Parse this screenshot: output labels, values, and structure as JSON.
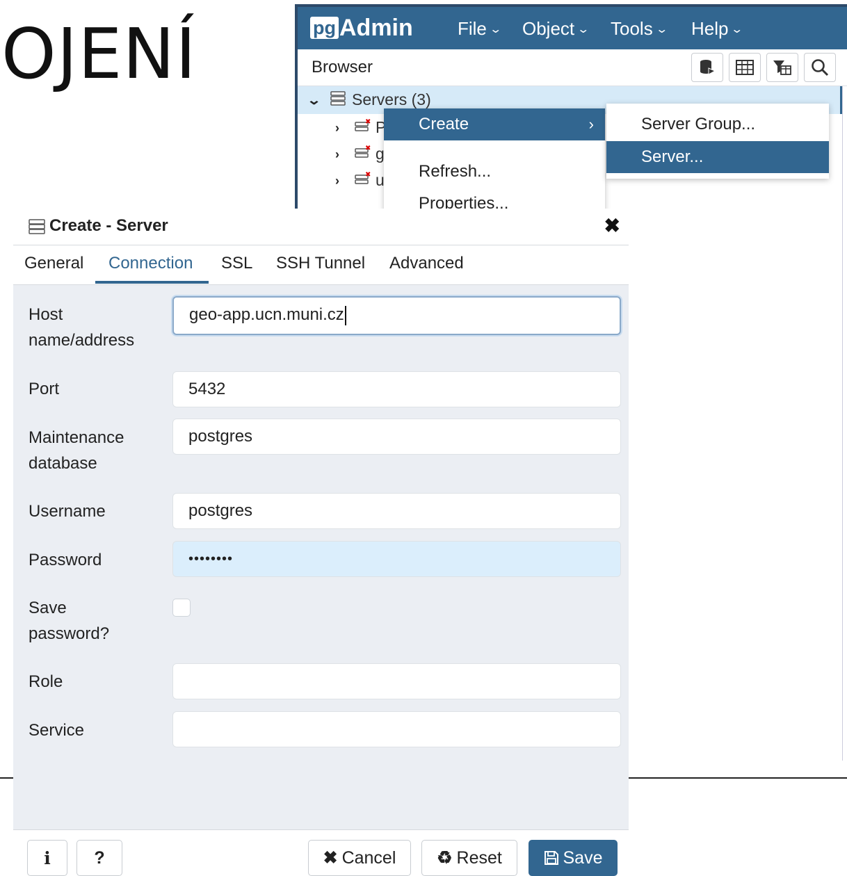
{
  "slide": {
    "title_fragment": "OJENÍ"
  },
  "app": {
    "logo_pg": "pg",
    "logo_admin": "Admin",
    "menus": [
      {
        "label": "File"
      },
      {
        "label": "Object"
      },
      {
        "label": "Tools"
      },
      {
        "label": "Help"
      }
    ],
    "browser_label": "Browser",
    "toolbar_icons": [
      "database-query-icon",
      "table-grid-icon",
      "filter-table-icon",
      "search-icon"
    ],
    "tree": {
      "root_label": "Servers (3)",
      "children": [
        {
          "label": "P"
        },
        {
          "label": "g"
        },
        {
          "label": "u"
        }
      ]
    },
    "context_menu": {
      "items": [
        {
          "label": "Create",
          "has_submenu": true
        },
        {
          "label": "Refresh..."
        },
        {
          "label": "Properties..."
        }
      ]
    },
    "submenu": {
      "items": [
        {
          "label": "Server Group..."
        },
        {
          "label": "Server..."
        }
      ]
    }
  },
  "dialog": {
    "title": "Create - Server",
    "close_glyph": "✖",
    "tabs": [
      {
        "label": "General"
      },
      {
        "label": "Connection",
        "active": true
      },
      {
        "label": "SSL"
      },
      {
        "label": "SSH Tunnel"
      },
      {
        "label": "Advanced"
      }
    ],
    "fields": {
      "host_label_1": "Host",
      "host_label_2": "name/address",
      "host_value": "geo-app.ucn.muni.cz",
      "port_label": "Port",
      "port_value": "5432",
      "maint_label_1": "Maintenance",
      "maint_label_2": "database",
      "maint_value": "postgres",
      "username_label": "Username",
      "username_value": "postgres",
      "password_label": "Password",
      "password_value": "••••••••",
      "save_pw_label_1": "Save",
      "save_pw_label_2": "password?",
      "save_pw_checked": false,
      "role_label": "Role",
      "role_value": "",
      "service_label": "Service",
      "service_value": ""
    },
    "footer": {
      "info_glyph": "i",
      "help_glyph": "?",
      "cancel_label": "Cancel",
      "cancel_glyph": "✖",
      "reset_label": "Reset",
      "reset_glyph": "♻",
      "save_label": "Save"
    }
  },
  "colors": {
    "brand": "#326690",
    "selection": "#d6eaf8",
    "dialog_bg": "#ebeef3",
    "password_bg": "#dbeefc"
  }
}
